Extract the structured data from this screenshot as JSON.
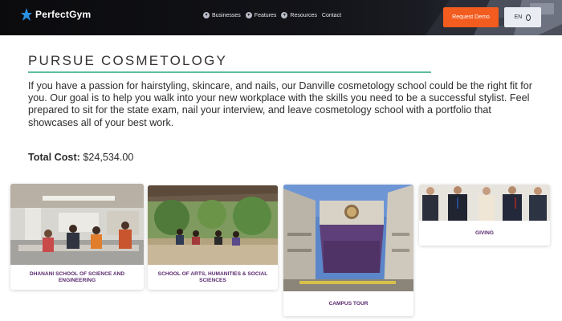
{
  "nav": {
    "logo_text": "PerfectGym",
    "links": [
      {
        "label": "Businesses",
        "icon": "chevron-down-icon"
      },
      {
        "label": "Features",
        "icon": "chevron-down-icon"
      },
      {
        "label": "Resources",
        "icon": "chevron-down-icon"
      },
      {
        "label": "Contact",
        "icon": ""
      }
    ],
    "demo_label": "Request Demo",
    "lang_label": "EN",
    "accent_color": "#f25c1f"
  },
  "main": {
    "heading": "PURSUE COSMETOLOGY",
    "body": "If you have a passion for hairstyling, skincare, and nails, our Danville cosmetology school could be the right fit for you. Our goal is to help you walk into your new workplace with the skills you need to be a successful stylist. Feel prepared to sit for the state exam, nail your interview, and leave cosmetology school with a portfolio that showcases all of your best work.",
    "cost_label": "Total Cost:",
    "cost_value": "$24,534.00",
    "rule_color": "#5fbe9a"
  },
  "cards": [
    {
      "label": "DHANANI SCHOOL OF SCIENCE AND ENGINEERING"
    },
    {
      "label": "SCHOOL OF ARTS, HUMANITIES & SOCIAL SCIENCES"
    },
    {
      "label": "CAMPUS TOUR"
    },
    {
      "label": "GIVING"
    }
  ],
  "card_label_color": "#5a2a6e"
}
